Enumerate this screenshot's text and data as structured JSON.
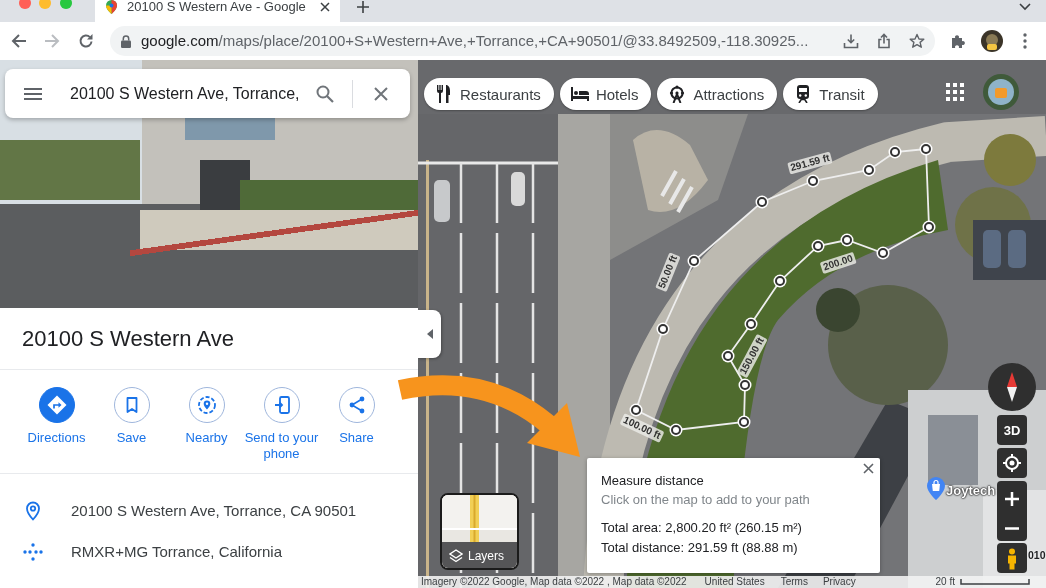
{
  "browser": {
    "tab_title": "20100 S Western Ave - Google",
    "url_host": "google.com",
    "url_path": "/maps/place/20100+S+Western+Ave,+Torrance,+CA+90501/@33.8492509,-118.30925..."
  },
  "search": {
    "value": "20100 S Western Ave, Torrance,"
  },
  "place": {
    "title": "20100 S Western Ave",
    "actions": [
      {
        "kind": "directions",
        "label": "Directions",
        "primary": true
      },
      {
        "kind": "save",
        "label": "Save",
        "primary": false
      },
      {
        "kind": "nearby",
        "label": "Nearby",
        "primary": false
      },
      {
        "kind": "send_to_phone",
        "label": "Send to your phone",
        "primary": false
      },
      {
        "kind": "share",
        "label": "Share",
        "primary": false
      }
    ],
    "details": [
      {
        "kind": "address",
        "text": "20100 S Western Ave, Torrance, CA 90501"
      },
      {
        "kind": "plus_code",
        "text": "RMXR+MG Torrance, California"
      }
    ]
  },
  "map": {
    "chips": [
      {
        "kind": "restaurants",
        "label": "Restaurants"
      },
      {
        "kind": "hotels",
        "label": "Hotels"
      },
      {
        "kind": "attractions",
        "label": "Attractions"
      },
      {
        "kind": "transit",
        "label": "Transit"
      }
    ],
    "path_labels": [
      "291.59 ft",
      "50.00 ft",
      "200.00",
      "150.00 ft",
      "100.00 ft"
    ],
    "poi_label": "Joytech",
    "edge_label": "010",
    "tilt_label": "3D",
    "layers_label": "Layers",
    "attribution": {
      "data": "Imagery ©2022 Google, Map data ©2022 , Map data ©2022",
      "region": "United States",
      "terms": "Terms",
      "privacy": "Privacy",
      "scale": "20 ft"
    }
  },
  "measure": {
    "title": "Measure distance",
    "hint": "Click on the map to add to your path",
    "area": "Total area: 2,800.20 ft² (260.15 m²)",
    "distance": "Total distance: 291.59 ft (88.88 m)"
  }
}
